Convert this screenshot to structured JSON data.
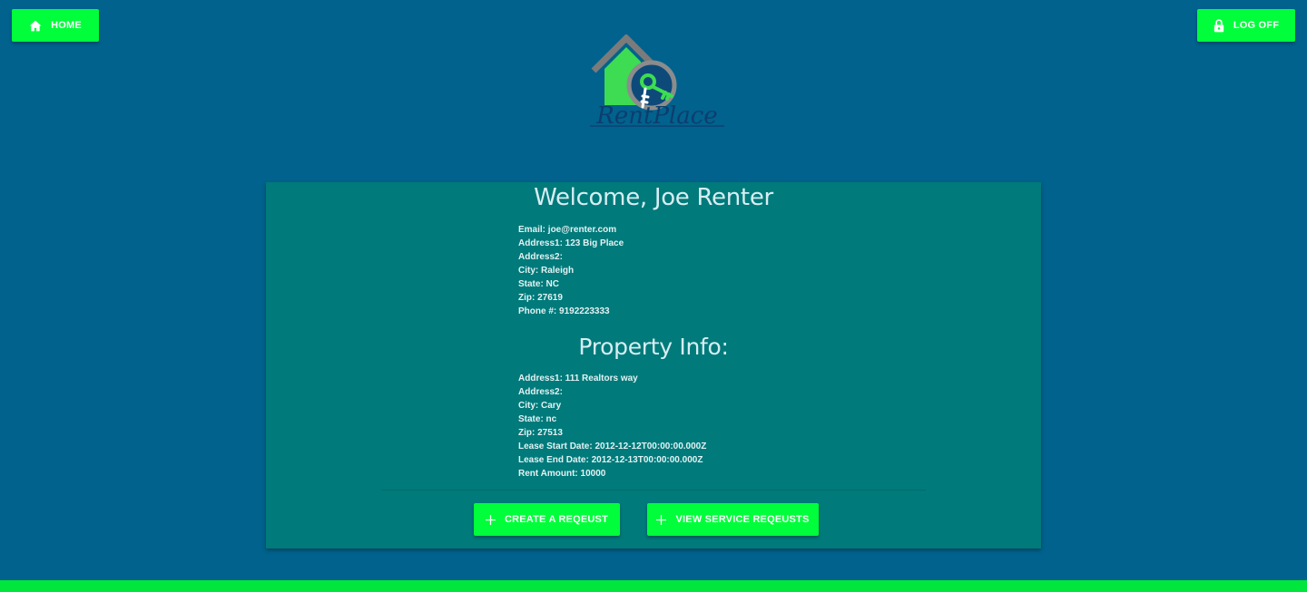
{
  "header": {
    "home_label": "HOME",
    "logoff_label": "LOG OFF",
    "logo_text": "RentPlace"
  },
  "welcome": {
    "title": "Welcome, Joe Renter",
    "fields": [
      "Email: joe@renter.com",
      "Address1: 123 Big Place",
      "Address2:",
      "City: Raleigh",
      "State: NC",
      "Zip: 27619",
      "Phone #: 9192223333"
    ]
  },
  "property": {
    "title": "Property Info:",
    "fields": [
      "Address1: 111 Realtors way",
      "Address2:",
      "City: Cary",
      "State: nc",
      "Zip: 27513",
      "Lease Start Date: 2012-12-12T00:00:00.000Z",
      "Lease End Date: 2012-12-13T00:00:00.000Z",
      "Rent Amount: 10000"
    ]
  },
  "actions": {
    "create_label": "CREATE A REQEUST",
    "view_label": "VIEW SERVICE REQEUSTS"
  },
  "icons": {
    "home": "home-icon",
    "logoff": "lock-icon",
    "add": "plus-icon"
  },
  "colors": {
    "background": "#00628d",
    "card": "#007a7a",
    "accent": "#00ff3a"
  }
}
